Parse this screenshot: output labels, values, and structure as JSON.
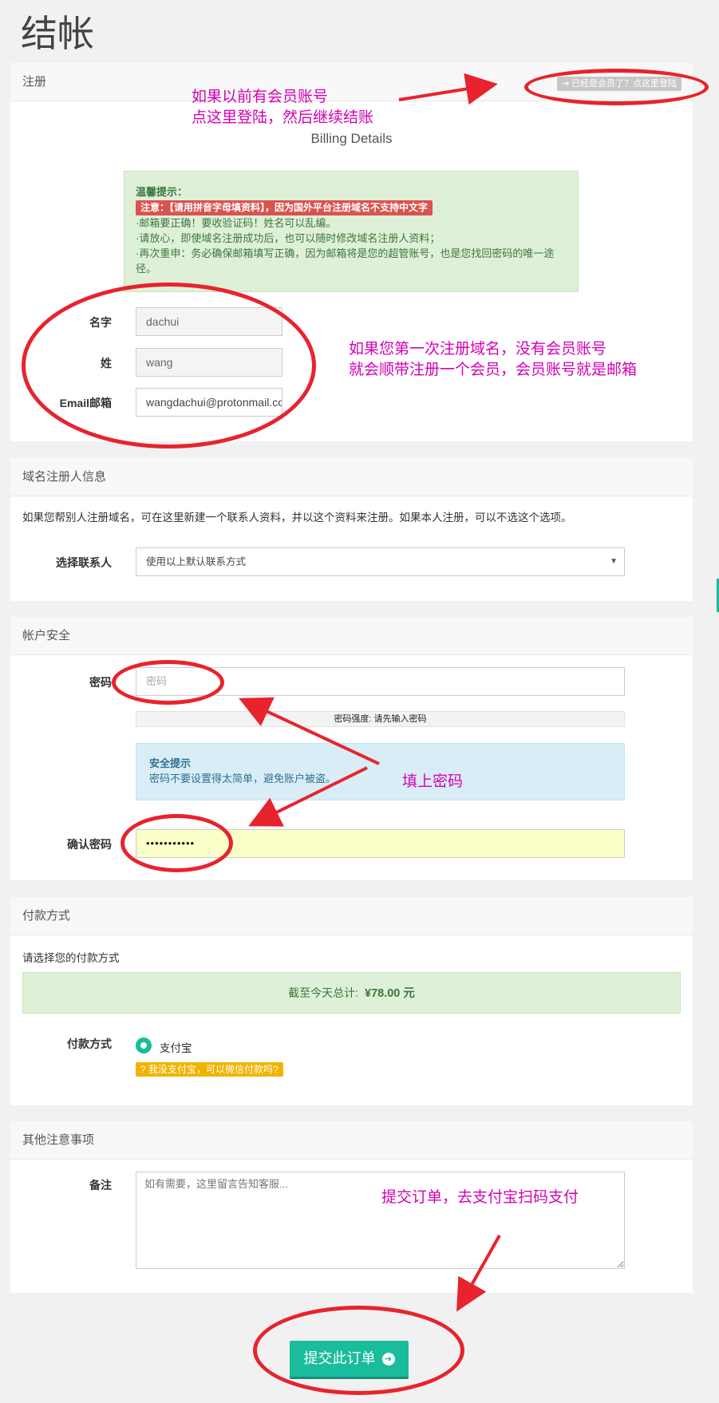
{
  "page": {
    "title": "结帐"
  },
  "registration": {
    "heading": "注册",
    "login_link": "已经是会员了？点这里登陆",
    "billing_title": "Billing Details",
    "tips": {
      "title": "温馨提示：",
      "warning": "注意：【请用拼音字母填资料】，因为国外平台注册域名不支持中文字",
      "line1": "·邮箱要正确！要收验证码！姓名可以乱编。",
      "line2": "·请放心，即使域名注册成功后，也可以随时修改域名注册人资料；",
      "line3": "·再次重申：务必确保邮箱填写正确，因为邮箱将是您的超管账号，也是您找回密码的唯一途径。"
    },
    "first_name": {
      "label": "名字",
      "value": "dachui"
    },
    "last_name": {
      "label": "姓",
      "value": "wang"
    },
    "email": {
      "label": "Email邮箱",
      "value": "wangdachui@protonmail.com"
    }
  },
  "registrant": {
    "heading": "域名注册人信息",
    "description": "如果您帮别人注册域名，可在这里新建一个联系人资料，并以这个资料来注册。如果本人注册，可以不选这个选项。",
    "contact_label": "选择联系人",
    "contact_value": "使用以上默认联系方式"
  },
  "security": {
    "heading": "帐户安全",
    "password_label": "密码",
    "password_placeholder": "密码",
    "strength_text": "密码强度: 请先输入密码",
    "tip_title": "安全提示",
    "tip_text": "密码不要设置得太简单，避免账户被盗。",
    "confirm_label": "确认密码",
    "confirm_value": "•••••••••••"
  },
  "payment": {
    "heading": "付款方式",
    "prompt": "请选择您的付款方式",
    "total_label": "截至今天总计:",
    "total_value": "¥78.00 元",
    "method_label": "付款方式",
    "method_option": "支付宝",
    "no_alipay_link": "我没支付宝，可以微信付款吗?"
  },
  "notes": {
    "heading": "其他注意事项",
    "label": "备注",
    "placeholder": "如有需要，这里留言告知客服..."
  },
  "submit": {
    "label": "提交此订单"
  },
  "annotations": {
    "login_line1": "如果以前有会员账号",
    "login_line2": "点这里登陆，然后继续结账",
    "register_line1": "如果您第一次注册域名，没有会员账号",
    "register_line2": "就会顺带注册一个会员，会员账号就是邮箱",
    "password": "填上密码",
    "submit": "提交订单，去支付宝扫码支付"
  },
  "colors": {
    "accent": "#1abc9c",
    "annotation": "#d400b4",
    "circle": "#e8232d"
  }
}
